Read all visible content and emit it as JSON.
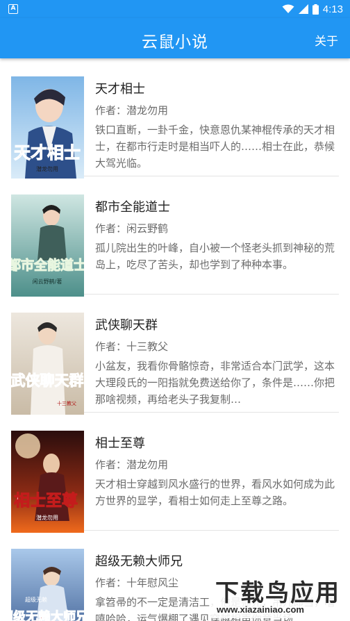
{
  "status_bar": {
    "time": "4:13",
    "left_icon_letter": "A",
    "icons": [
      "notification-a-icon",
      "wifi-icon",
      "signal-icon",
      "battery-icon"
    ]
  },
  "app_bar": {
    "title": "云鼠小说",
    "about_label": "关于"
  },
  "colors": {
    "primary": "#2196F3",
    "title_text": "#222222",
    "secondary_text": "#6b6b6b",
    "divider": "#e3e3e3"
  },
  "books": [
    {
      "title": "天才相士",
      "author": "作者：潜龙勿用",
      "desc": "铁口直断，一卦千金，快意恩仇某神棍传承的天才相士，在都市行走时是相当吓人的……相士在此，恭候大驾光临。",
      "cover_title": "天才相士",
      "cover_author": "潜龙勿用"
    },
    {
      "title": "都市全能道士",
      "author": "作者：闲云野鹤",
      "desc": "孤儿院出生的叶峰，自小被一个怪老头抓到神秘的荒岛上，吃尽了苦头，却也学到了种种本事。",
      "cover_title": "都市全能道士",
      "cover_author": "闲云野鹤/著"
    },
    {
      "title": "武侠聊天群",
      "author": "作者：十三教父",
      "desc": "小盆友，我看你骨骼惊奇，非常适合本门武学，这本大理段氏的一阳指就免费送给你了，条件是……你把那啥视频，再给老头子我复制…",
      "cover_title": "武侠聊天群",
      "cover_author": "十三教父"
    },
    {
      "title": "相士至尊",
      "author": "作者：潜龙勿用",
      "desc": "天才相士穿越到风水盛行的世界，看风水如何成为此方世界的显学，看相士如何走上至尊之路。",
      "cover_title": "相士至尊",
      "cover_author": "潜龙勿用"
    },
    {
      "title": "超级无赖大师兄",
      "author": "作者：十年慰风尘",
      "desc": "拿笤帚的不一定是清洁工，他是师兄，吊儿郎当，嘻嘻哈哈，运气爆棚了遇见穿越相声你意当场",
      "cover_title": "超级无赖大师兄",
      "cover_author": "超级无赖"
    }
  ],
  "watermark": {
    "main": "下载鸟应用",
    "url": "www.xiazainiao.com"
  }
}
